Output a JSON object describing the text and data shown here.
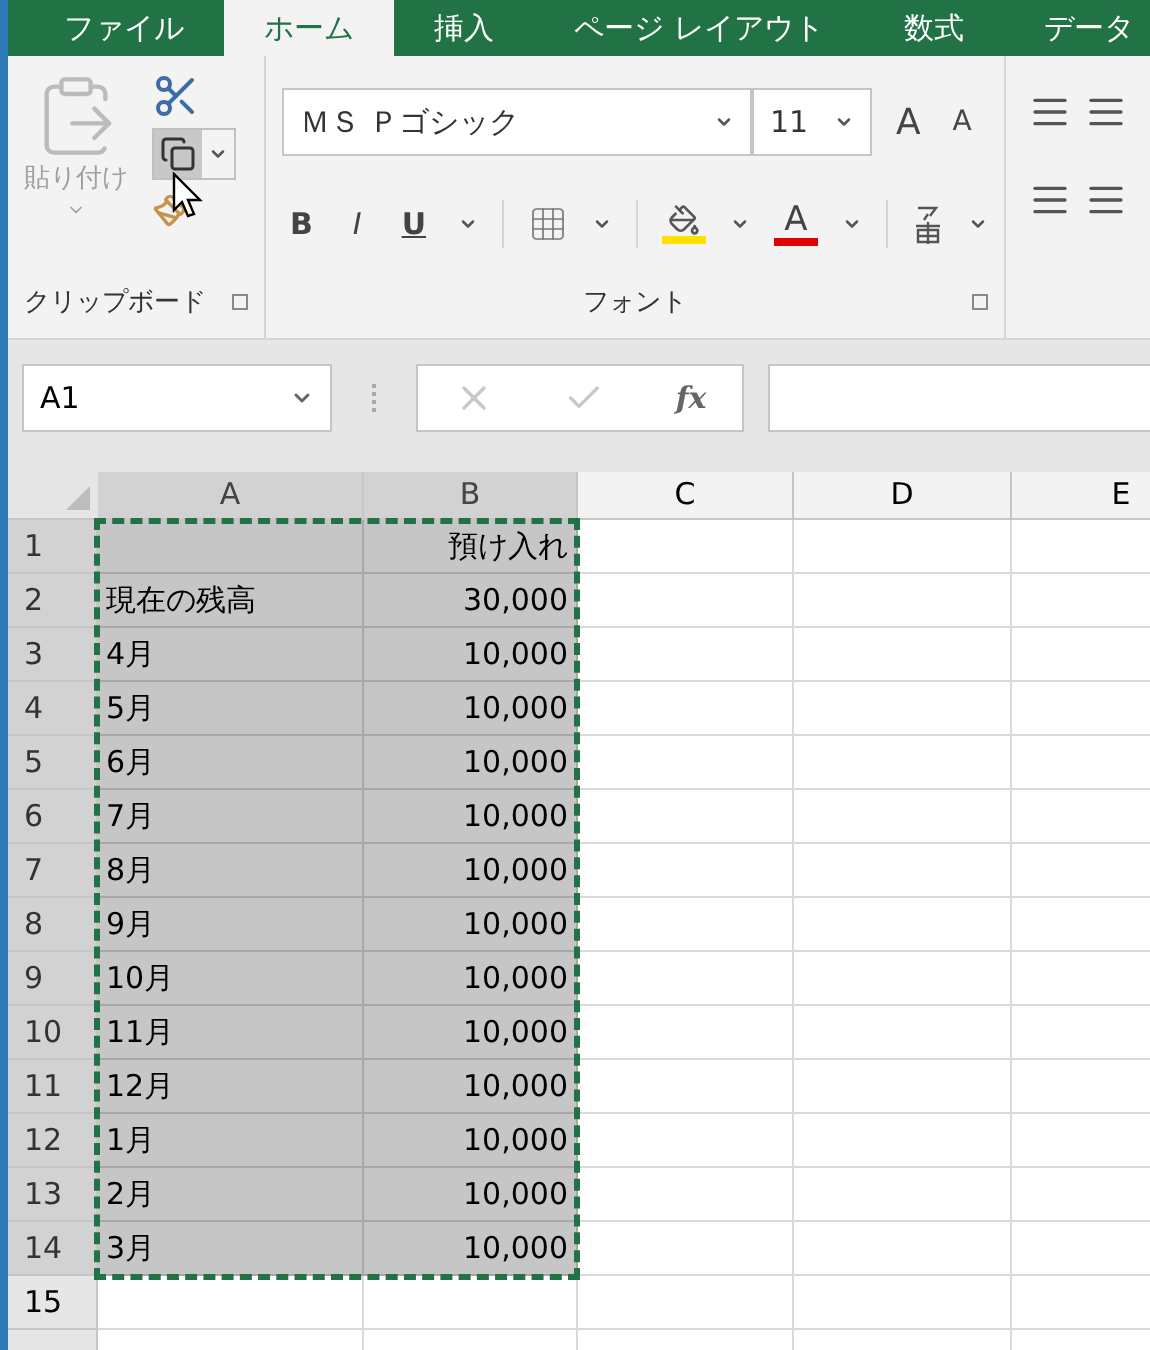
{
  "tabs": [
    {
      "label": "ファイル",
      "selected": false
    },
    {
      "label": "ホーム",
      "selected": true
    },
    {
      "label": "挿入",
      "selected": false
    },
    {
      "label": "ページ レイアウト",
      "selected": false
    },
    {
      "label": "数式",
      "selected": false
    },
    {
      "label": "データ",
      "selected": false
    }
  ],
  "ribbon": {
    "clipboard": {
      "paste_label": "貼り付け",
      "group_label": "クリップボード"
    },
    "font": {
      "font_name": "ＭＳ Ｐゴシック",
      "font_size": "11",
      "grow_label": "A",
      "shrink_label": "A",
      "bold_label": "B",
      "italic_label": "I",
      "underline_label": "U",
      "font_color_label": "A",
      "group_label": "フォント"
    }
  },
  "formula_bar": {
    "name_box": "A1",
    "fx_label": "fx"
  },
  "grid": {
    "columns": [
      {
        "label": "A",
        "selected": true
      },
      {
        "label": "B",
        "selected": true
      },
      {
        "label": "C",
        "selected": false
      },
      {
        "label": "D",
        "selected": false
      },
      {
        "label": "E",
        "selected": false
      }
    ],
    "rows": [
      {
        "number": "1",
        "selected": true,
        "cells": [
          "",
          "預け入れ"
        ]
      },
      {
        "number": "2",
        "selected": true,
        "cells": [
          "現在の残高",
          "30,000"
        ]
      },
      {
        "number": "3",
        "selected": true,
        "cells": [
          "4月",
          "10,000"
        ]
      },
      {
        "number": "4",
        "selected": true,
        "cells": [
          "5月",
          "10,000"
        ]
      },
      {
        "number": "5",
        "selected": true,
        "cells": [
          "6月",
          "10,000"
        ]
      },
      {
        "number": "6",
        "selected": true,
        "cells": [
          "7月",
          "10,000"
        ]
      },
      {
        "number": "7",
        "selected": true,
        "cells": [
          "8月",
          "10,000"
        ]
      },
      {
        "number": "8",
        "selected": true,
        "cells": [
          "9月",
          "10,000"
        ]
      },
      {
        "number": "9",
        "selected": true,
        "cells": [
          "10月",
          "10,000"
        ]
      },
      {
        "number": "10",
        "selected": true,
        "cells": [
          "11月",
          "10,000"
        ]
      },
      {
        "number": "11",
        "selected": true,
        "cells": [
          "12月",
          "10,000"
        ]
      },
      {
        "number": "12",
        "selected": true,
        "cells": [
          "1月",
          "10,000"
        ]
      },
      {
        "number": "13",
        "selected": true,
        "cells": [
          "2月",
          "10,000"
        ]
      },
      {
        "number": "14",
        "selected": true,
        "cells": [
          "3月",
          "10,000"
        ]
      },
      {
        "number": "15",
        "selected": false,
        "cells": [
          "",
          ""
        ]
      }
    ]
  }
}
